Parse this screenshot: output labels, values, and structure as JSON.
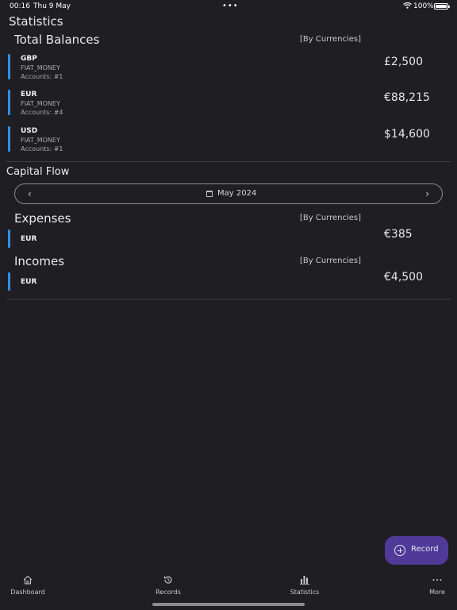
{
  "status_bar": {
    "time": "00:16",
    "date": "Thu 9 May",
    "multitask_dots": "•••",
    "battery_pct": "100%"
  },
  "page": {
    "title": "Statistics"
  },
  "total_balances": {
    "title": "Total Balances",
    "by_currencies": "[By Currencies]",
    "items": [
      {
        "code": "GBP",
        "type": "FIAT_MONEY",
        "accounts": "Accounts: #1",
        "amount": "£2,500"
      },
      {
        "code": "EUR",
        "type": "FIAT_MONEY",
        "accounts": "Accounts: #4",
        "amount": "€88,215"
      },
      {
        "code": "USD",
        "type": "FIAT_MONEY",
        "accounts": "Accounts: #1",
        "amount": "$14,600"
      }
    ]
  },
  "capital_flow": {
    "title": "Capital Flow",
    "month": "May 2024",
    "prev_glyph": "‹",
    "next_glyph": "›",
    "expenses": {
      "title": "Expenses",
      "by_currencies": "[By Currencies]",
      "items": [
        {
          "code": "EUR",
          "amount": "€385"
        }
      ]
    },
    "incomes": {
      "title": "Incomes",
      "by_currencies": "[By Currencies]",
      "items": [
        {
          "code": "EUR",
          "amount": "€4,500"
        }
      ]
    }
  },
  "fab": {
    "label": "Record"
  },
  "tabs": [
    {
      "label": "Dashboard",
      "icon": "home-icon"
    },
    {
      "label": "Records",
      "icon": "history-icon"
    },
    {
      "label": "Statistics",
      "icon": "chart-icon"
    },
    {
      "label": "More",
      "icon": "more-icon"
    }
  ],
  "colors": {
    "background": "#1f1e23",
    "accent_bar": "#2f8ee5",
    "fab": "#4f3a98"
  }
}
